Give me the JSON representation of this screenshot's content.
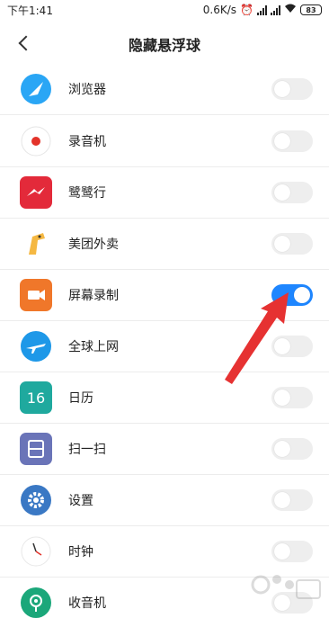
{
  "status_bar": {
    "time": "下午1:41",
    "speed": "0.6K/s",
    "battery": "83"
  },
  "header": {
    "title": "隐藏悬浮球"
  },
  "apps": [
    {
      "label": "浏览器",
      "icon": "browser-icon",
      "color": "#2aa6f5",
      "enabled": false
    },
    {
      "label": "录音机",
      "icon": "recorder-icon",
      "color": "#e3332a",
      "enabled": false
    },
    {
      "label": "鹭鹭行",
      "icon": "travel-icon",
      "color": "#e32a3a",
      "enabled": false
    },
    {
      "label": "美团外卖",
      "icon": "giraffe-icon",
      "color": "#f5b842",
      "enabled": false
    },
    {
      "label": "屏幕录制",
      "icon": "screen-record-icon",
      "color": "#f0772a",
      "enabled": true
    },
    {
      "label": "全球上网",
      "icon": "plane-icon",
      "color": "#1e98e8",
      "enabled": false
    },
    {
      "label": "日历",
      "icon": "calendar-icon",
      "color": "#1fa99e",
      "enabled": false,
      "text": "16"
    },
    {
      "label": "扫一扫",
      "icon": "scan-icon",
      "color": "#6a74b8",
      "enabled": false
    },
    {
      "label": "设置",
      "icon": "gear-icon",
      "color": "#3a78c4",
      "enabled": false
    },
    {
      "label": "时钟",
      "icon": "clock-icon",
      "color": "#ffffff",
      "enabled": false
    },
    {
      "label": "收音机",
      "icon": "radio-icon",
      "color": "#1ba77a",
      "enabled": false
    }
  ],
  "colors": {
    "toggle_on": "#1e86ff",
    "toggle_off": "#eeeeee",
    "arrow": "#e63232"
  }
}
